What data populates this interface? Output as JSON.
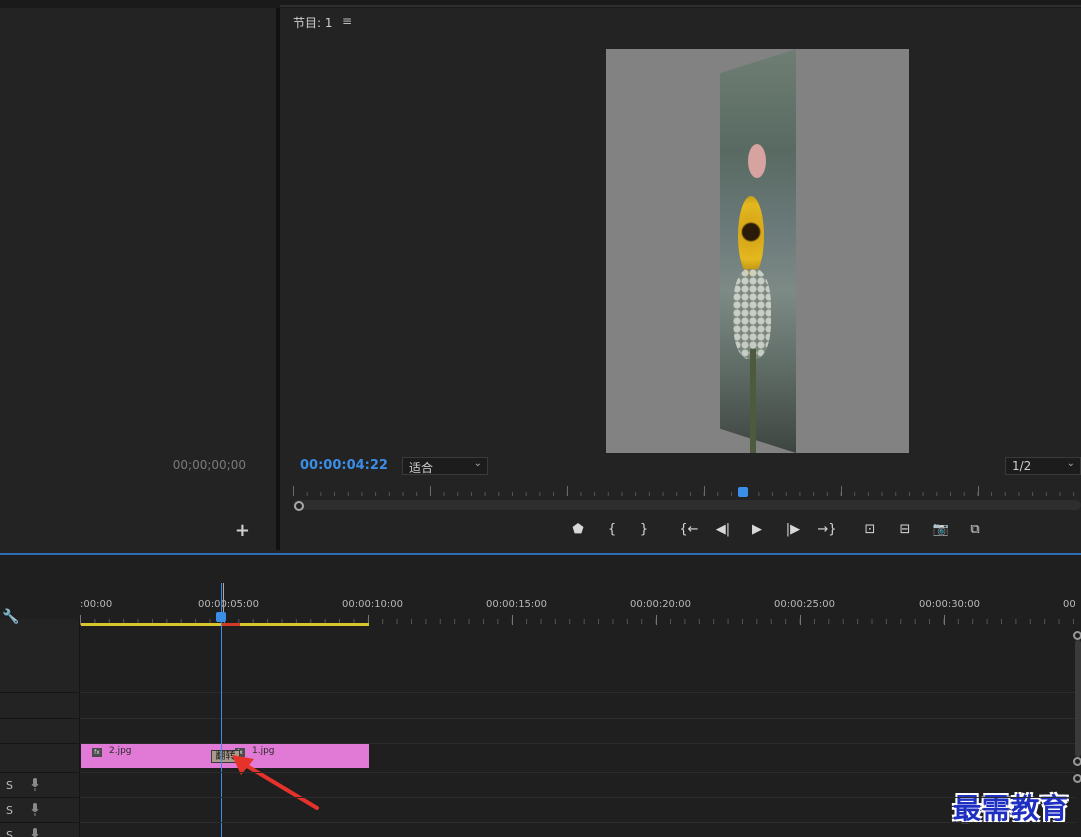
{
  "source": {
    "timecode": "00;00;00;00",
    "add_icon": "plus-icon"
  },
  "program": {
    "title": "节目: 1",
    "menu_icon": "≡",
    "timecode": "00:00:04:22",
    "fit_dropdown": "适合",
    "resolution_dropdown": "1/2",
    "controls": [
      {
        "name": "add-marker-button",
        "glyph": "⬟"
      },
      {
        "name": "mark-in-button",
        "glyph": "{"
      },
      {
        "name": "mark-out-button",
        "glyph": "}"
      },
      {
        "name": "go-to-in-button",
        "glyph": "{←"
      },
      {
        "name": "step-back-button",
        "glyph": "◀|"
      },
      {
        "name": "play-button",
        "glyph": "▶"
      },
      {
        "name": "step-forward-button",
        "glyph": "|▶"
      },
      {
        "name": "go-to-out-button",
        "glyph": "→}"
      },
      {
        "name": "lift-button",
        "glyph": "⊡"
      },
      {
        "name": "extract-button",
        "glyph": "⊟"
      },
      {
        "name": "export-frame-button",
        "glyph": "📷"
      },
      {
        "name": "comparison-view-button",
        "glyph": "⧉"
      }
    ]
  },
  "timeline": {
    "ruler_labels": [
      ":00:00",
      "00:00:05:00",
      "00:00:10:00",
      "00:00:15:00",
      "00:00:20:00",
      "00:00:25:00",
      "00:00:30:00",
      "00"
    ],
    "clips": [
      {
        "name": "2.jpg",
        "fx": "fx"
      },
      {
        "name": "1.jpg",
        "fx": "fx"
      }
    ],
    "transition_label": "翻转",
    "audio_tracks": [
      {
        "s_label": "S"
      },
      {
        "s_label": "S"
      },
      {
        "s_label": "S"
      }
    ],
    "accent_color": "#3b8ee8",
    "clip_color": "#e07ad6",
    "work_area_color": "#d9c62c"
  },
  "watermark": "最需教育"
}
